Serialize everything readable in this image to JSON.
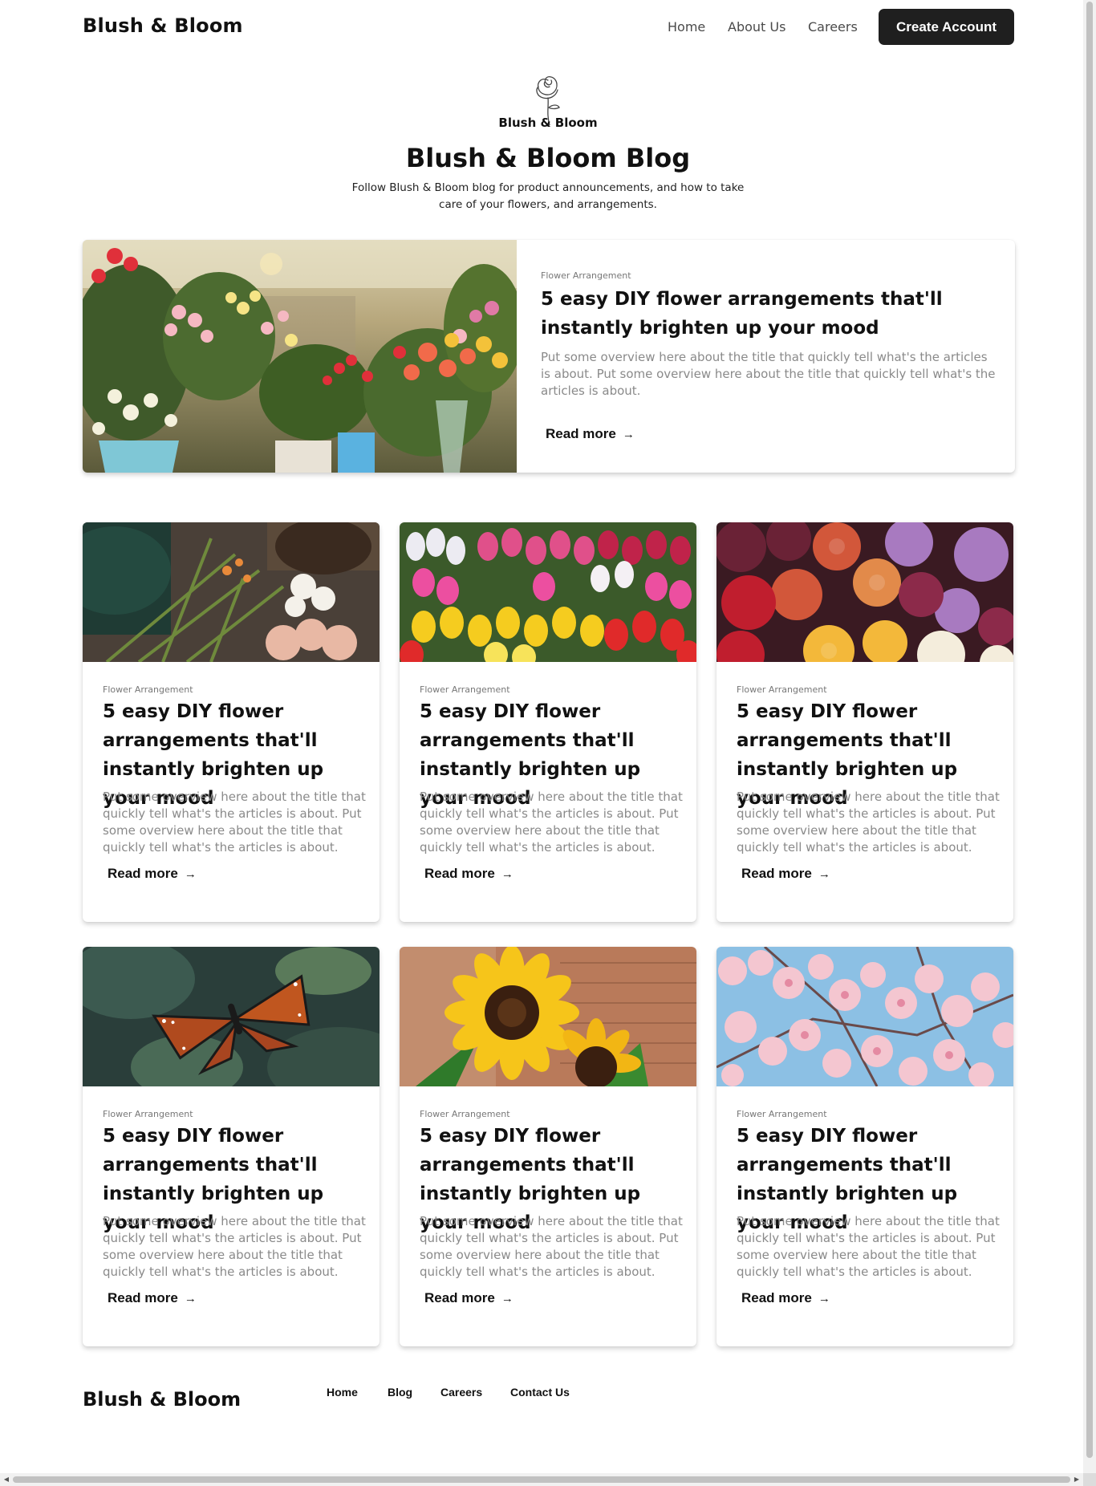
{
  "header": {
    "brand": "Blush & Bloom",
    "nav": [
      "Home",
      "About Us",
      "Careers"
    ],
    "cta": "Create Account"
  },
  "hero": {
    "logo_text": "Blush & Bloom",
    "title": "Blush & Bloom Blog",
    "subtitle": "Follow Blush & Bloom blog for product announcements, and how to take care of your flowers, and arrangements."
  },
  "featured": {
    "category": "Flower Arrangement",
    "title": "5 easy DIY flower arrangements that'll instantly brighten up your mood",
    "excerpt": "Put some overview here about the title that quickly tell what's the articles is about. Put some overview here about the title that quickly tell what's the articles is about.",
    "read_more": "Read more"
  },
  "posts": [
    {
      "category": "Flower Arrangement",
      "title": "5 easy DIY flower arrangements that'll instantly brighten up your mood",
      "excerpt": "Put some overview here about the title that quickly tell what's the articles is about. Put some overview here about the title that quickly tell what's the articles is about.",
      "read_more": "Read more"
    },
    {
      "category": "Flower Arrangement",
      "title": "5 easy DIY flower arrangements that'll instantly brighten up your mood",
      "excerpt": "Put some overview here about the title that quickly tell what's the articles is about. Put some overview here about the title that quickly tell what's the articles is about.",
      "read_more": "Read more"
    },
    {
      "category": "Flower Arrangement",
      "title": "5 easy DIY flower arrangements that'll instantly brighten up your mood",
      "excerpt": "Put some overview here about the title that quickly tell what's the articles is about. Put some overview here about the title that quickly tell what's the articles is about.",
      "read_more": "Read more"
    },
    {
      "category": "Flower Arrangement",
      "title": "5 easy DIY flower arrangements that'll instantly brighten up your mood",
      "excerpt": "Put some overview here about the title that quickly tell what's the articles is about. Put some overview here about the title that quickly tell what's the articles is about.",
      "read_more": "Read more"
    },
    {
      "category": "Flower Arrangement",
      "title": "5 easy DIY flower arrangements that'll instantly brighten up your mood",
      "excerpt": "Put some overview here about the title that quickly tell what's the articles is about. Put some overview here about the title that quickly tell what's the articles is about.",
      "read_more": "Read more"
    },
    {
      "category": "Flower Arrangement",
      "title": "5 easy DIY flower arrangements that'll instantly brighten up your mood",
      "excerpt": "Put some overview here about the title that quickly tell what's the articles is about. Put some overview here about the title that quickly tell what's the articles is about.",
      "read_more": "Read more"
    }
  ],
  "footer": {
    "brand": "Blush & Bloom",
    "nav": [
      "Home",
      "Blog",
      "Careers",
      "Contact Us"
    ]
  },
  "colors": {
    "primary_button": "#1f1f1f",
    "muted_text": "#8a8a8a",
    "nav_text": "#4a4a4a"
  },
  "icons": {
    "read_more_arrow": "arrow-right-icon",
    "logo": "rose-icon"
  }
}
